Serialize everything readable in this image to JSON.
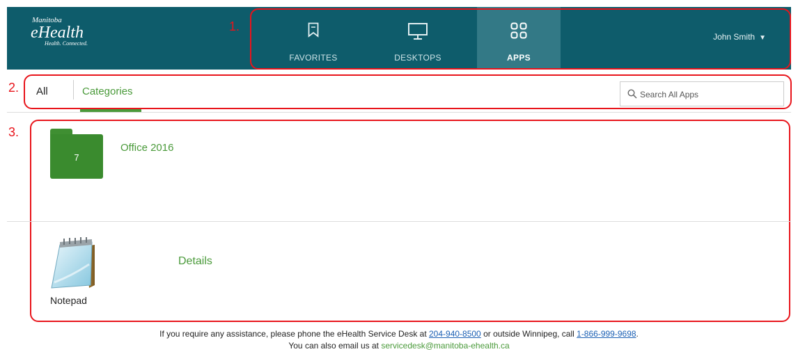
{
  "header": {
    "logo": {
      "top": "Manitoba",
      "main": "eHealth",
      "tagline": "Health. Connected."
    },
    "nav": [
      {
        "label": "FAVORITES",
        "icon": "bookmark-icon",
        "active": false
      },
      {
        "label": "DESKTOPS",
        "icon": "monitor-icon",
        "active": false
      },
      {
        "label": "APPS",
        "icon": "apps-grid-icon",
        "active": true
      }
    ],
    "user": {
      "name": "John Smith",
      "caret": "▼"
    }
  },
  "annotations": {
    "one": "1.",
    "two": "2.",
    "three": "3."
  },
  "tabs": {
    "all": "All",
    "categories": "Categories"
  },
  "search": {
    "placeholder": "Search All Apps"
  },
  "folders": [
    {
      "name": "Office 2016",
      "count": "7"
    }
  ],
  "apps": [
    {
      "name": "Notepad",
      "details_label": "Details"
    }
  ],
  "footer": {
    "line1_prefix": "If you require any assistance, please phone the eHealth Service Desk at ",
    "phone1": "204-940-8500",
    "line1_mid": " or outside Winnipeg, call ",
    "phone2": "1-866-999-9698",
    "line1_suffix": ".",
    "line2_prefix": "You can also email us at ",
    "email": "servicedesk@manitoba-ehealth.ca"
  },
  "colors": {
    "header_bg": "#0e5c6b",
    "active_nav": "#337986",
    "accent_green": "#4a9a3a",
    "annotation_red": "#e8141b"
  }
}
